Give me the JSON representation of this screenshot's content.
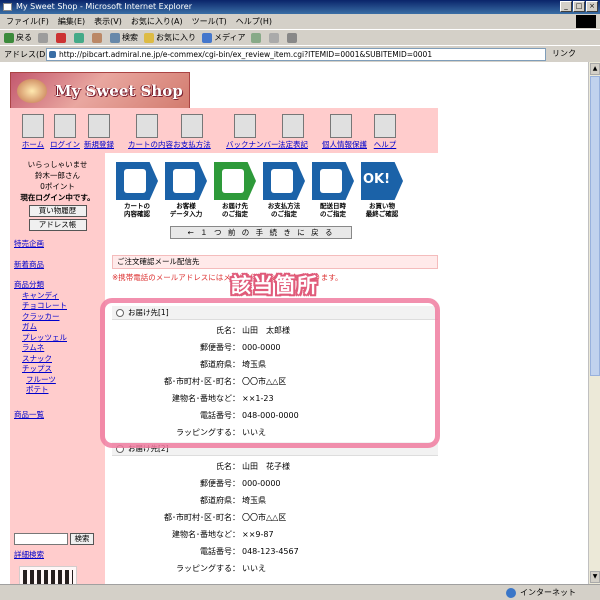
{
  "window": {
    "title": "My Sweet Shop - Microsoft Internet Explorer"
  },
  "menubar": {
    "items": [
      "ファイル(F)",
      "編集(E)",
      "表示(V)",
      "お気に入り(A)",
      "ツール(T)",
      "ヘルプ(H)"
    ]
  },
  "toolbar": {
    "back": "戻る",
    "search": "検索",
    "favorites": "お気に入り",
    "media": "メディア"
  },
  "address": {
    "label": "アドレス(D)",
    "url": "http://pibcart.admiral.ne.jp/e-commex/cgi-bin/ex_review_item.cgi?ITEMID=0001&SUBITEMID=0001",
    "go": "リンク"
  },
  "shop": {
    "logo_text": "My Sweet Shop"
  },
  "nav": {
    "items": [
      "ホーム",
      "ログイン",
      "新規登録",
      "カートの内容",
      "お支払方法",
      "バックナンバー",
      "法定表記",
      "個人情報保護",
      "ヘルプ"
    ]
  },
  "sidebar": {
    "greeting": "いらっしゃいませ",
    "user": "鈴木一郎さん",
    "points": "0ポイント",
    "login_status": "現在ログイン中です。",
    "history_button": "買い物履歴",
    "address_button": "アドレス帳",
    "links": {
      "special": "特売企画",
      "new": "新着商品",
      "category": "商品分類",
      "candy": "キャンディ",
      "chocolate": "チョコレート",
      "cracker": "クラッカー",
      "gum": "ガム",
      "pretzel": "プレッツェル",
      "ramune": "ラムネ",
      "snack": "スナック",
      "chips": "チップス",
      "fruit": "フルーツ",
      "potato": "ポテト",
      "list": "商品一覧"
    },
    "search_button": "検索",
    "advanced_search": "詳細検索"
  },
  "steps": [
    {
      "line1": "カートの",
      "line2": "内容確認"
    },
    {
      "line1": "お客様",
      "line2": "データ入力"
    },
    {
      "line1": "お届け先",
      "line2": "のご指定"
    },
    {
      "line1": "お支払方法",
      "line2": "のご指定"
    },
    {
      "line1": "配送日時",
      "line2": "のご指定"
    },
    {
      "line1": "お買い物",
      "line2": "最終ご確認"
    }
  ],
  "back_button": "← １ つ 前 の 手 続 き に 戻 る",
  "confirm_mail": "ご注文確認メール配信先",
  "warning_text": "※携帯電話のメールアドレスにはメールが届かない場合があります。",
  "callout": "該当箇所",
  "labels": {
    "name": "氏名：",
    "zip": "郵便番号：",
    "pref": "都道府県：",
    "city": "都･市町村･区･町名：",
    "street": "建物名･番地など：",
    "tel": "電話番号：",
    "wrap": "ラッピングする："
  },
  "destinations": [
    {
      "header": "お届け先[1]",
      "name": "山田　太郎様",
      "zip": "000-0000",
      "pref": "埼玉県",
      "city": "〇〇市△△区",
      "street": "××1-23",
      "tel": "048-000-0000",
      "wrap": "いいえ"
    },
    {
      "header": "お届け先[2]",
      "name": "山田　花子様",
      "zip": "000-0000",
      "pref": "埼玉県",
      "city": "〇〇市△△区",
      "street": "××9-87",
      "tel": "048-123-4567",
      "wrap": "いいえ"
    }
  ],
  "status": {
    "zone": "インターネット"
  },
  "colors": {
    "page_pink": "#ffcccc",
    "step_blue": "#1b62a8",
    "step_current": "#2e9a3a",
    "highlight": "#f07ca0",
    "link": "#0000cc"
  }
}
